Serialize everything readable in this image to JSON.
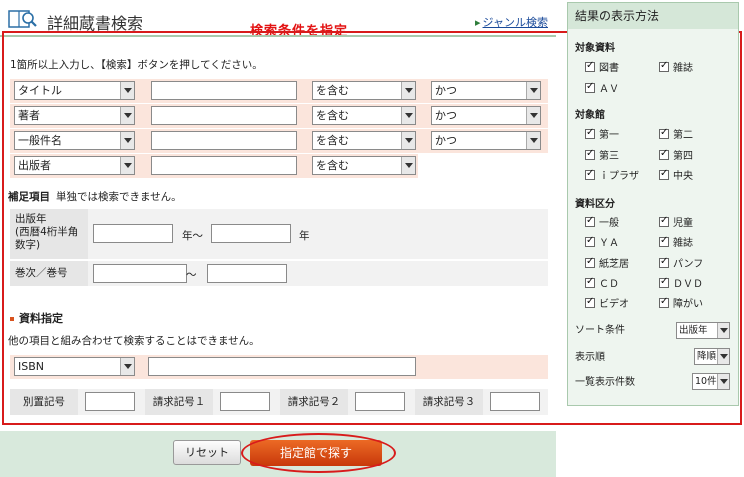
{
  "header": {
    "title": "詳細蔵書検索",
    "genre_link": "ジャンル検索",
    "annotation": "検索条件を指定"
  },
  "form": {
    "instruction": "1箇所以上入力し、【検索】ボタンを押してください。",
    "terms": [
      {
        "field": "タイトル",
        "value": "",
        "match": "を含む",
        "op": "かつ"
      },
      {
        "field": "著者",
        "value": "",
        "match": "を含む",
        "op": "かつ"
      },
      {
        "field": "一般件名",
        "value": "",
        "match": "を含む",
        "op": "かつ"
      },
      {
        "field": "出版者",
        "value": "",
        "match": "を含む"
      }
    ],
    "supplementary": {
      "title": "補足項目",
      "note": "単独では検索できません。",
      "pubyear_label": "出版年\n(西暦4桁半角数字)",
      "pubyear_from": "",
      "pubyear_to": "",
      "year_tilde": "年～",
      "year_end": "年",
      "volume_label": "巻次／巻号",
      "volume_from": "",
      "volume_to": "",
      "tilde": "～"
    },
    "material": {
      "title": "資料指定",
      "desc": "他の項目と組み合わせて検索することはできません。",
      "id_type": "ISBN",
      "id_value": "",
      "codes": [
        {
          "label": "別置記号",
          "value": ""
        },
        {
          "label": "請求記号１",
          "value": ""
        },
        {
          "label": "請求記号２",
          "value": ""
        },
        {
          "label": "請求記号３",
          "value": ""
        }
      ]
    },
    "reset_label": "リセット",
    "search_label": "指定館で探す"
  },
  "panel": {
    "header": "結果の表示方法",
    "target_material": {
      "title": "対象資料",
      "items": [
        {
          "label": "図書",
          "checked": true
        },
        {
          "label": "雑誌",
          "checked": true
        },
        {
          "label": "ＡＶ",
          "checked": true
        }
      ]
    },
    "target_library": {
      "title": "対象館",
      "items": [
        {
          "label": "第一",
          "checked": true
        },
        {
          "label": "第二",
          "checked": true
        },
        {
          "label": "第三",
          "checked": true
        },
        {
          "label": "第四",
          "checked": true
        },
        {
          "label": "ｉプラザ",
          "checked": true
        },
        {
          "label": "中央",
          "checked": true
        }
      ]
    },
    "material_type": {
      "title": "資料区分",
      "items": [
        {
          "label": "一般",
          "checked": true
        },
        {
          "label": "児童",
          "checked": true
        },
        {
          "label": "ＹＡ",
          "checked": true
        },
        {
          "label": "雑誌",
          "checked": true
        },
        {
          "label": "紙芝居",
          "checked": true
        },
        {
          "label": "パンフ",
          "checked": true
        },
        {
          "label": "ＣＤ",
          "checked": true
        },
        {
          "label": "ＤＶＤ",
          "checked": true
        },
        {
          "label": "ビデオ",
          "checked": true
        },
        {
          "label": "障がい",
          "checked": true
        }
      ]
    },
    "sort_label": "ソート条件",
    "sort_value": "出版年",
    "order_label": "表示順",
    "order_value": "降順",
    "count_label": "一覧表示件数",
    "count_value": "10件"
  },
  "colors": {
    "accent": "#d9531e",
    "annotation_red": "#d81b1b",
    "panel_green": "#d5e7d8",
    "row_pink": "#fbe5dc"
  }
}
